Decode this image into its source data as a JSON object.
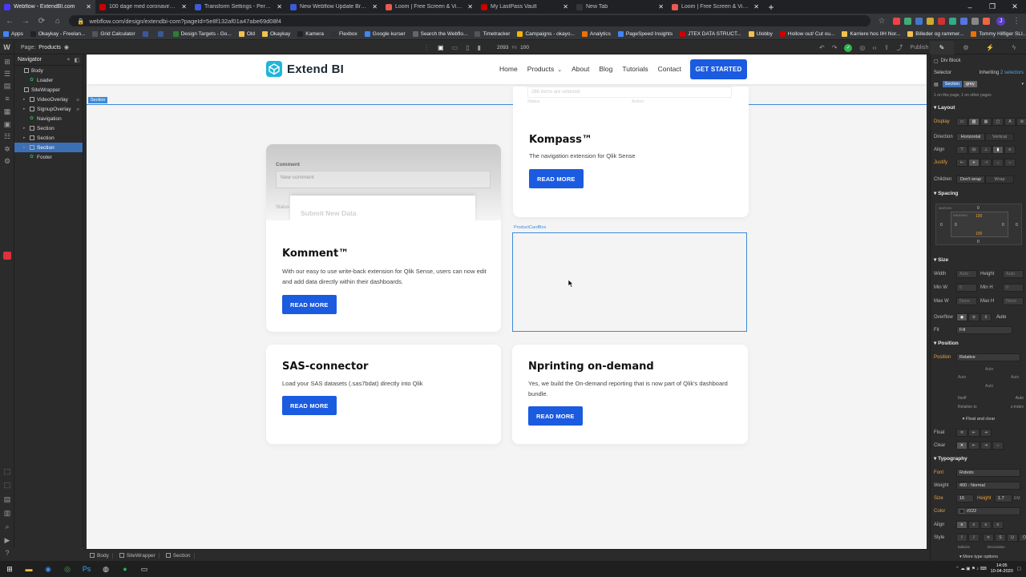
{
  "browser": {
    "tabs": [
      {
        "title": "Webflow - ExtendBI.com",
        "active": true,
        "color": "#4a3aff"
      },
      {
        "title": "100 dage med coronavirussens",
        "active": false,
        "color": "#c00"
      },
      {
        "title": "Transform Settings - Perspective",
        "active": false,
        "color": "#3b5bdb"
      },
      {
        "title": "New Webflow Update Breaks Gr",
        "active": false,
        "color": "#3b5bdb"
      },
      {
        "title": "Loom | Free Screen & Video Rec",
        "active": false,
        "color": "#e85a4f"
      },
      {
        "title": "My LastPass Vault",
        "active": false,
        "color": "#c00"
      },
      {
        "title": "New Tab",
        "active": false,
        "color": "#35363a"
      },
      {
        "title": "Loom | Free Screen & Video Rec",
        "active": false,
        "color": "#e85a4f"
      }
    ],
    "new_tab_icon": "+",
    "window_controls": [
      "–",
      "❐",
      "✕"
    ],
    "url": "webflow.com/design/extendbi-com?pageId=5e8f132af01a47abe69d08f4",
    "bookmarks": [
      "Apps",
      "Okaykay - Freelan...",
      "Grid Calculator",
      "",
      "",
      "Design Targets - Go...",
      "Old",
      "Okaykay",
      "Kamera",
      "Flexbox",
      "Google kurser",
      "Search the Webflo...",
      "Timetracker",
      "Campaigns - okayo...",
      "Analytics",
      "PageSpeed Insights",
      "JTEX DATA STRUCT...",
      "Ulobby",
      "Hollow out/ Cut ou...",
      "Karriere hos IIH Nor...",
      "Billeder og rammer...",
      "Tommy Hilfiger SLI..."
    ],
    "profile_initial": "J"
  },
  "webflow": {
    "page_label": "Page:",
    "page_name": "Products",
    "canvas_width": "2093",
    "canvas_px": "PX",
    "canvas_zoom": "100",
    "publish": "Publish",
    "navigator_title": "Navigator",
    "tree": [
      {
        "label": "Body",
        "indent": 0,
        "kind": "box",
        "selected": false
      },
      {
        "label": "Loader",
        "indent": 1,
        "kind": "sym",
        "selected": false
      },
      {
        "label": "SiteWrapper",
        "indent": 0,
        "kind": "box",
        "selected": false
      },
      {
        "label": "VideoOverlay",
        "indent": 1,
        "kind": "box",
        "selected": false
      },
      {
        "label": "SignupOverlay",
        "indent": 1,
        "kind": "box",
        "selected": false
      },
      {
        "label": "Navigation",
        "indent": 1,
        "kind": "sym",
        "selected": false
      },
      {
        "label": "Section",
        "indent": 1,
        "kind": "box",
        "selected": false
      },
      {
        "label": "Section",
        "indent": 1,
        "kind": "box",
        "selected": false
      },
      {
        "label": "Section",
        "indent": 1,
        "kind": "box",
        "selected": true
      },
      {
        "label": "Footer",
        "indent": 1,
        "kind": "sym",
        "selected": false
      }
    ],
    "breadcrumbs": [
      "Body",
      "SiteWrapper",
      "Section"
    ],
    "section_label": "Section",
    "product_box_label": "ProductCardBox"
  },
  "site": {
    "brand": "Extend BI",
    "brand_color": "#1a5be0",
    "menu": [
      "Home",
      "Products",
      "About",
      "Blog",
      "Tutorials",
      "Contact"
    ],
    "cta": "GET STARTED",
    "kompass": {
      "ghost_text": "288 items are selected",
      "ghost_label1": "Status",
      "ghost_label2": "Action",
      "title": "Kompass™",
      "desc": "The navigation extension for Qlik Sense",
      "button": "READ MORE"
    },
    "komment": {
      "preview_label": "Comment",
      "preview_placeholder": "New comment",
      "preview_status": "Status",
      "preview_modal": "Submit New Data",
      "title": "Komment™",
      "desc": "With our easy to use write-back extension for Qlik Sense, users can now edit and add data directly within their dashboards.",
      "button": "READ MORE"
    },
    "sas": {
      "title": "SAS-connector",
      "desc": "Load your SAS datasets (.sas7bdat) directly into Qlik",
      "button": "READ MORE"
    },
    "nprint": {
      "title": "Nprinting on-demand",
      "desc": "Yes, we build the On-demand reporting that is now part of Qlik's dashboard bundle.",
      "button": "READ MORE"
    }
  },
  "style_panel": {
    "element": "Div Block",
    "selector": "Selector",
    "inheriting": "Inheriting",
    "inheriting_count": "2 selectors",
    "class1": "Section",
    "class2": "grey",
    "usage": "1 on this page, 1 on other pages",
    "layout": "Layout",
    "display": "Display",
    "direction": "Direction",
    "horizontal": "Horizontal",
    "vertical": "Vertical",
    "align": "Align",
    "justify": "Justify",
    "children": "Children",
    "dont_wrap": "Don't wrap",
    "wrap": "Wrap",
    "spacing": "Spacing",
    "margin": "MARGIN",
    "padding": "PADDING",
    "pad_top": "100",
    "pad_bottom": "100",
    "zero": "0",
    "size": "Size",
    "width": "Width",
    "height": "Height",
    "min_w": "Min W",
    "min_h": "Min H",
    "max_w": "Max W",
    "max_h": "Max H",
    "auto": "Auto",
    "none": "None",
    "px": "PX",
    "overflow": "Overflow",
    "fit": "Fit",
    "fill": "Fill",
    "position": "Position",
    "position_value": "Relative",
    "itself": "Itself",
    "relative_to": "Relative to",
    "z_index": "z-index",
    "float_clear": "Float and clear",
    "float": "Float",
    "clear": "Clear",
    "typography": "Typography",
    "font": "Font",
    "font_value": "Roboto",
    "weight": "Weight",
    "weight_value": "400 - Normal",
    "size_value": "16",
    "height_value": "1.7",
    "em": "EM",
    "color": "Color",
    "color_value": "#222",
    "style": "Style",
    "italicize": "Italicize",
    "decoration": "Decoration",
    "more_type": "More type options"
  },
  "taskbar": {
    "time": "14:05",
    "date": "10-04-2020"
  }
}
